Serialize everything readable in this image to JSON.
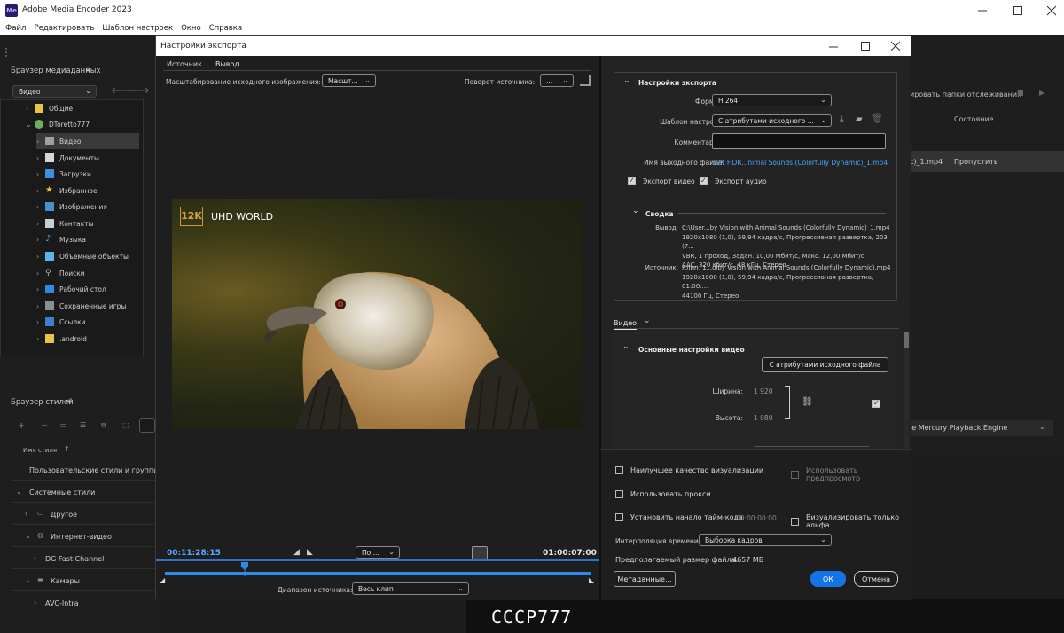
{
  "app": {
    "title": "Adobe Media Encoder 2023",
    "logo": "Me",
    "window_controls": [
      "minimize-icon",
      "maximize-icon",
      "close-icon"
    ]
  },
  "menu": [
    "Файл",
    "Редактировать",
    "Шаблон настроек",
    "Окно",
    "Справка"
  ],
  "media_browser": {
    "title": "Браузер медиаданных",
    "view_select": "Видео",
    "items": [
      {
        "label": "Общие",
        "icon": "folder-icon"
      },
      {
        "label": "DToretto777",
        "icon": "user-icon"
      },
      {
        "label": "Видео",
        "icon": "video-icon"
      },
      {
        "label": "Документы",
        "icon": "document-icon"
      },
      {
        "label": "Загрузки",
        "icon": "download-icon"
      },
      {
        "label": "Избранное",
        "icon": "star-icon"
      },
      {
        "label": "Изображения",
        "icon": "image-icon"
      },
      {
        "label": "Контакты",
        "icon": "contacts-icon"
      },
      {
        "label": "Музыка",
        "icon": "music-icon"
      },
      {
        "label": "Объемные объекты",
        "icon": "cube-icon"
      },
      {
        "label": "Поиски",
        "icon": "search-icon"
      },
      {
        "label": "Рабочий стол",
        "icon": "desktop-icon"
      },
      {
        "label": "Сохраненные игры",
        "icon": "game-icon"
      },
      {
        "label": "Ссылки",
        "icon": "link-icon"
      },
      {
        "label": ".android",
        "icon": "folder-icon"
      }
    ]
  },
  "style_browser": {
    "title": "Браузер стилей",
    "search_placeholder": "",
    "column": "Имя стиля",
    "rows": [
      {
        "label": "Пользовательские стили и группы"
      },
      {
        "label": "Системные стили"
      },
      {
        "label": "Другое"
      },
      {
        "label": "Интернет-видео"
      },
      {
        "label": "DG Fast Channel"
      },
      {
        "label": "Камеры"
      },
      {
        "label": "AVC-Intra"
      }
    ]
  },
  "queue": {
    "watch_folders": "ировать папки отслеживания",
    "status_header": "Состояние",
    "file_suffix": "c)_1.mp4",
    "status_value": "Пропустить",
    "renderer": "ie Mercury Playback Engine",
    "monitor_text": "СССР777"
  },
  "dialog": {
    "title": "Настройки экспорта",
    "tabs": [
      "Источник",
      "Вывод"
    ],
    "source_scaling_label": "Масштабирование исходного изображения:",
    "source_scaling_value": "Масшт...",
    "rotation_label": "Поворот источника:",
    "rotation_value": "...",
    "preview_overlay_logo": "12K",
    "preview_overlay_text": "UHD WORLD",
    "timecode_current": "00:11:28:15",
    "timecode_end": "01:00:07:00",
    "fit_select": "По ...",
    "range_label": "Диапазон источника:",
    "range_value": "Весь клип",
    "export_settings": {
      "title": "Настройки экспорта",
      "format_label": "Формат:",
      "format_value": "H.264",
      "preset_label": "Шаблон настроек:",
      "preset_value": "С атрибутами исходного ...",
      "comments_label": "Комментарии:",
      "comments_value": "",
      "output_name_label": "Имя выходного файла:",
      "output_name_value": "12K HDR...nimal Sounds (Colorfully Dynamic)_1.mp4",
      "export_video": "Экспорт видео",
      "export_audio": "Экспорт аудио"
    },
    "summary": {
      "title": "Сводка",
      "output_label": "Вывод:",
      "output_lines": [
        "C:\\User...by Vision with Animal Sounds (Colorfully Dynamic)_1.mp4",
        "1920x1080 (1,0), 59,94 кадра/с, Прогрессивная развертка, 203 (7...",
        "VBR, 1 проход, Задан. 10,00 Мбит/с, Макс. 12,00 Мбит/с",
        "AAC, 320 кбит/с, 48 кГц, Стерео"
      ],
      "source_label": "Источник:",
      "source_lines": [
        "Клип, 1...olby Vision with Animal Sounds (Colorfully Dynamic).mp4",
        "1920x1080 (1,0), 59,94 кадра/с, Прогрессивная развертка, 01:00:...",
        "44100 Гц, Стерео"
      ]
    },
    "video": {
      "tab": "Видео",
      "section_title": "Основные настройки видео",
      "match_source_button": "С атрибутами исходного файла",
      "width_label": "Ширина:",
      "width_value": "1 920",
      "height_label": "Высота:",
      "height_value": "1 080"
    },
    "bottom": {
      "max_quality": "Наилучшее качество визуализации",
      "use_previews": "Использовать предпросмотр",
      "use_proxies": "Использовать прокси",
      "set_start_timecode": "Установить начало тайм-кода",
      "start_timecode_value": "00:00:00:00",
      "render_alpha": "Визуализировать только альфа",
      "interp_label": "Интерполяция времени:",
      "interp_value": "Выборка кадров",
      "est_size_label": "Предполагаемый размер файла:",
      "est_size_value": "4657 МБ",
      "metadata_button": "Метаданные...",
      "ok_button": "ОК",
      "cancel_button": "Отмена"
    },
    "colors": {
      "accent": "#2d8ceb",
      "link": "#4aa3ff",
      "timecode": "#5aa8ff"
    }
  }
}
